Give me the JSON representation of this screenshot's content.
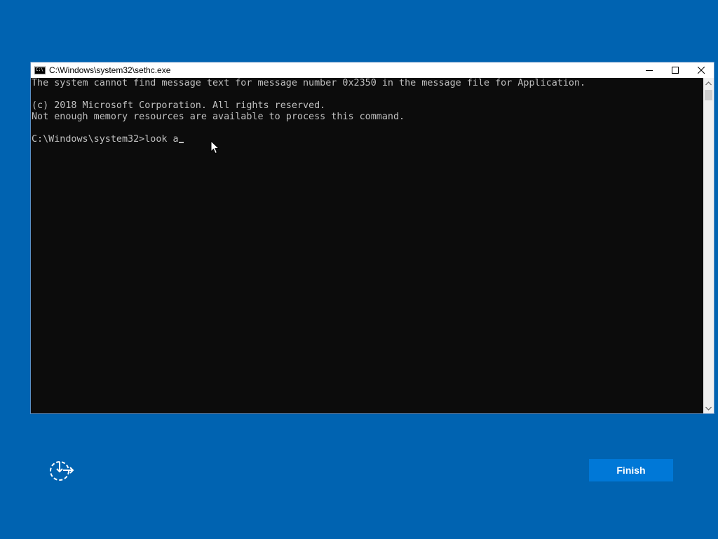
{
  "window": {
    "title": "C:\\Windows\\system32\\sethc.exe",
    "icon": "console-icon"
  },
  "console": {
    "lines": [
      "The system cannot find message text for message number 0x2350 in the message file for Application.",
      "",
      "(c) 2018 Microsoft Corporation. All rights reserved.",
      "Not enough memory resources are available to process this command.",
      ""
    ],
    "prompt": "C:\\Windows\\system32>",
    "input": "look a"
  },
  "footer": {
    "finish_label": "Finish",
    "left_icon": "reset-restart-icon"
  },
  "colors": {
    "desktop_bg": "#0063b1",
    "console_bg": "#0c0c0c",
    "console_text": "#c0c0c0",
    "button_bg": "#0078d7"
  }
}
